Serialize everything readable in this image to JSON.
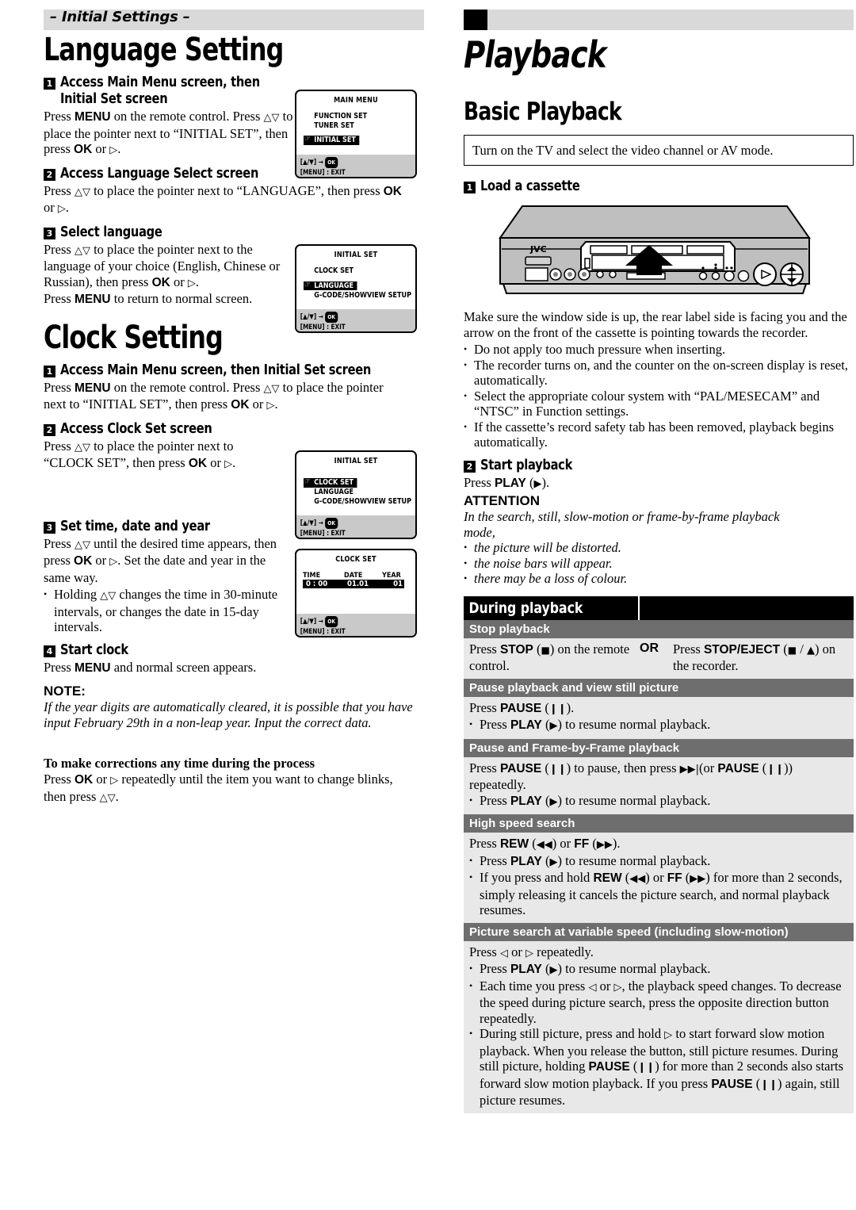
{
  "left": {
    "running_head": "– Initial Settings –",
    "section1_title": "Language Setting",
    "lang_steps": [
      {
        "num": "1",
        "title": "Access Main Menu screen, then Initial Set screen",
        "body": "Press MENU on the remote control. Press △▽ to place the pointer next to “INITIAL SET”, then press OK or ▷."
      },
      {
        "num": "2",
        "title": "Access Language Select screen",
        "body": "Press △▽ to place the pointer next to “LANGUAGE”, then press OK or ▷."
      },
      {
        "num": "3",
        "title": "Select language",
        "body": "Press △▽ to place the pointer next to the language of your choice (English, Chinese or Russian), then press OK or ▷. Press MENU to return to normal screen."
      }
    ],
    "section2_title": "Clock Setting",
    "clock_steps": [
      {
        "num": "1",
        "title": "Access Main Menu screen, then Initial Set screen",
        "body": "Press MENU on the remote control. Press △▽ to place the pointer next to “INITIAL SET”, then press OK or ▷."
      },
      {
        "num": "2",
        "title": "Access Clock Set screen",
        "body": "Press △▽ to place the pointer next to “CLOCK SET”, then press OK or ▷."
      },
      {
        "num": "3",
        "title": "Set time, date and year",
        "body": "Press △▽ until the desired time appears, then press OK or ▷. Set the date and year in the same way.",
        "bullets": [
          "Holding △▽ changes the time in 30-minute intervals, or changes the date in 15-day intervals."
        ]
      },
      {
        "num": "4",
        "title": "Start clock",
        "body": "Press MENU and normal screen appears."
      }
    ],
    "note_heading": "NOTE:",
    "note_body": "If the year digits are automatically cleared, it is possible that you have input February 29th in a non-leap year. Input the correct data.",
    "correction_heading": "To make corrections any time during the process",
    "correction_body": "Press OK or ▷ repeatedly until the item you want to change blinks, then press △▽."
  },
  "osd_screens": [
    {
      "id": "main-menu",
      "title": "MAIN MENU",
      "items": [
        "FUNCTION SET",
        "TUNER SET",
        "INITIAL SET"
      ],
      "selected_index": 2,
      "footer_line1": "[▲/▼] →",
      "footer_ok": "OK",
      "footer_line2": "[MENU] : EXIT"
    },
    {
      "id": "initial-set-language",
      "title": "INITIAL SET",
      "items": [
        "CLOCK SET",
        "LANGUAGE",
        "G-CODE/SHOWVIEW SETUP"
      ],
      "selected_index": 1,
      "footer_line1": "[▲/▼] →",
      "footer_ok": "OK",
      "footer_line2": "[MENU] : EXIT"
    },
    {
      "id": "initial-set-clock",
      "title": "INITIAL SET",
      "items": [
        "CLOCK SET",
        "LANGUAGE",
        "G-CODE/SHOWVIEW SETUP"
      ],
      "selected_index": 0,
      "footer_line1": "[▲/▼] →",
      "footer_ok": "OK",
      "footer_line2": "[MENU] : EXIT"
    },
    {
      "id": "clock-set",
      "title": "CLOCK SET",
      "col_headers": [
        "TIME",
        "DATE",
        "YEAR"
      ],
      "values": [
        "0 : 00",
        "01.01",
        "01"
      ],
      "footer_line1": "[▲/▼] →",
      "footer_ok": "OK",
      "footer_line2": "[MENU] : EXIT"
    }
  ],
  "right": {
    "chapter_title": "Playback",
    "section_title": "Basic Playback",
    "tv_box": "Turn on the TV and select the video channel or AV mode.",
    "step1_num": "1",
    "step1_title": "Load a cassette",
    "vcr_brand": "JVC",
    "step1_body": "Make sure the window side is up, the rear label side is facing you and the arrow on the front of the cassette is pointing towards the recorder.",
    "step1_bullets": [
      "Do not apply too much pressure when inserting.",
      "The recorder turns on, and the counter on the on-screen display is reset, automatically.",
      "Select the appropriate colour system with “PAL/MESECAM” and “NTSC” in Function settings.",
      "If the cassette’s record safety tab has been removed, playback begins automatically."
    ],
    "step2_num": "2",
    "step2_title": "Start playback",
    "step2_body": "Press PLAY (▶).",
    "attention_heading": "ATTENTION",
    "attention_body": "In the search, still, slow-motion or frame-by-frame playback mode,",
    "attention_bullets": [
      "the picture will be distorted.",
      "the noise bars will appear.",
      "there may be a loss of colour."
    ],
    "table_title": "During playback",
    "table_rows": [
      {
        "header": "Stop playback",
        "type": "two-col",
        "col1": "Press STOP (■) on the remote control.",
        "or": "OR",
        "col2": "Press STOP/EJECT (■ / ▲) on the recorder."
      },
      {
        "header": "Pause playback and view still picture",
        "type": "simple",
        "lines": [
          "Press PAUSE (❙❙)."
        ],
        "bullets": [
          "Press PLAY (▶) to resume normal playback."
        ]
      },
      {
        "header": "Pause and Frame-by-Frame playback",
        "type": "simple",
        "lines": [
          "Press PAUSE (❙❙) to pause, then press ▶▶| (or PAUSE (❙❙)) repeatedly."
        ],
        "bullets": [
          "Press PLAY (▶) to resume normal playback."
        ]
      },
      {
        "header": "High speed search",
        "type": "simple",
        "lines": [
          "Press REW (◀◀) or FF (▶▶)."
        ],
        "bullets": [
          "Press PLAY (▶) to resume normal playback.",
          "If you press and hold REW (◀◀) or FF (▶▶) for more than 2 seconds, simply releasing it cancels the picture search, and normal playback resumes."
        ]
      },
      {
        "header": "Picture search at variable speed (including slow-motion)",
        "type": "simple",
        "lines": [
          "Press ◁ or ▷ repeatedly."
        ],
        "bullets": [
          "Press PLAY (▶) to resume normal playback.",
          "Each time you press ◁ or ▷, the playback speed changes. To decrease the speed during picture search, press the opposite direction button repeatedly.",
          "During still picture, press and hold ▷ to start forward slow motion playback. When you release the button, still picture resumes. During still picture, holding PAUSE (❙❙) for more than 2 seconds also starts forward slow motion playback. If you press PAUSE (❙❙) again, still picture resumes."
        ]
      }
    ]
  },
  "colors": {
    "band_gray": "#d9d9d9",
    "row_header_gray": "#6e6e6e",
    "row_body_gray": "#e8e8e8",
    "osd_footer_gray": "#c9c9c9",
    "black": "#000000"
  }
}
